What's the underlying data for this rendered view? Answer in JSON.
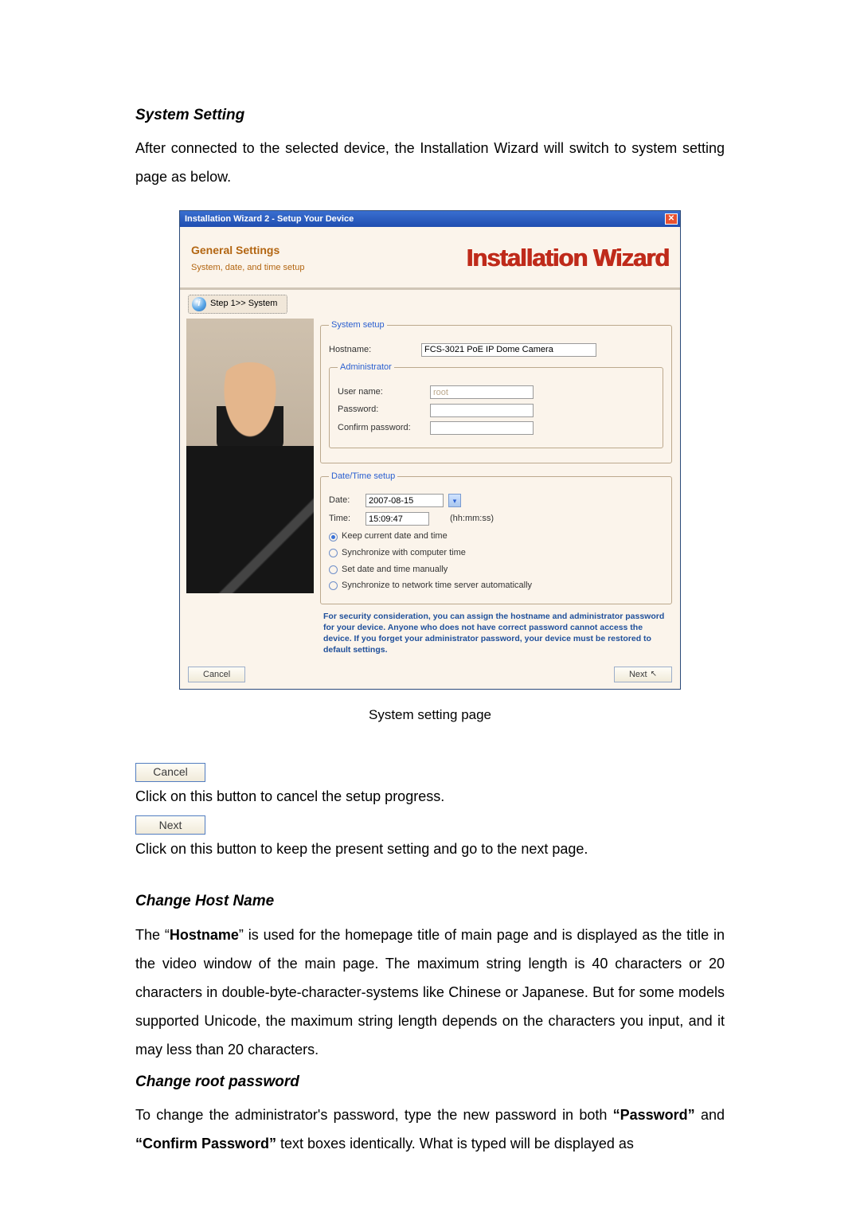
{
  "sections": {
    "system_setting_title": "System Setting",
    "system_setting_body": "After connected to the selected device, the Installation Wizard will switch to system setting page as below.",
    "caption": "System setting page",
    "cancel_inline": "Cancel",
    "cancel_desc": "Click on this button to cancel the setup progress.",
    "next_inline": "Next",
    "next_desc": "Click on this button to keep the present setting and go to the next page.",
    "change_host_title": "Change Host Name",
    "change_host_body_pre": "The “",
    "hostname_bold": "Hostname",
    "change_host_body_post": "” is used for the homepage title of main page and is displayed as the title in the video window of the main page. The maximum string length is 40 characters or 20 characters in double-byte-character-systems like Chinese or Japanese. But for some models supported Unicode, the maximum string length depends on the characters you input, and it may less than 20 characters.",
    "change_root_title": "Change root password",
    "change_root_body_pre": "To change the administrator's password, type the new password in both ",
    "password_bold": "“Password”",
    "change_root_mid": " and ",
    "confirm_bold": "“Confirm Password”",
    "change_root_body_post": " text boxes identically. What is typed will be displayed as"
  },
  "dialog": {
    "title": "Installation Wizard 2 - Setup Your Device",
    "gs_title": "General Settings",
    "gs_sub": "System, date, and time setup",
    "iw_logo": "Installation Wizard",
    "step_tab": "Step 1>> System",
    "system_setup_legend": "System setup",
    "hostname_label": "Hostname:",
    "hostname_value": "FCS-3021 PoE IP Dome Camera",
    "admin_legend": "Administrator",
    "username_label": "User name:",
    "username_value": "root",
    "password_label": "Password:",
    "password_value": "",
    "confirm_password_label": "Confirm password:",
    "confirm_password_value": "",
    "datetime_legend": "Date/Time setup",
    "date_label": "Date:",
    "date_value": "2007-08-15",
    "time_label": "Time:",
    "time_value": "15:09:47",
    "time_hint": "(hh:mm:ss)",
    "radio_keep": "Keep current date and time",
    "radio_sync_computer": "Synchronize with computer time",
    "radio_manual": "Set date and time manually",
    "radio_ntp": "Synchronize to network time server automatically",
    "note": "For security consideration, you can assign the hostname and administrator password for your device. Anyone who does not have correct password cannot access the device. If you forget your administrator password, your device must be restored to default settings.",
    "cancel_btn": "Cancel",
    "next_btn": "Next"
  }
}
